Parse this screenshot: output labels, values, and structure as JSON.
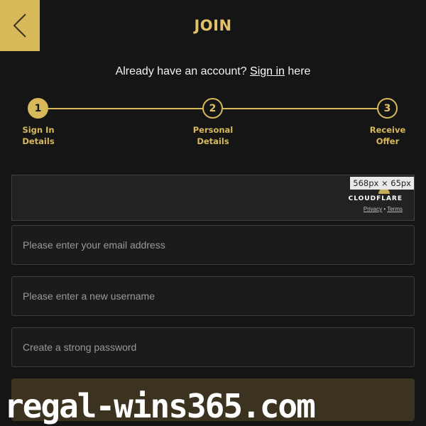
{
  "header": {
    "title": "JOIN",
    "back_icon": "chevron-left-icon"
  },
  "signin": {
    "prefix": "Already have an account? ",
    "link": "Sign in",
    "suffix": " here"
  },
  "steps": [
    {
      "number": "1",
      "label_line1": "Sign In",
      "label_line2": "Details",
      "active": true
    },
    {
      "number": "2",
      "label_line1": "Personal",
      "label_line2": "Details",
      "active": false
    },
    {
      "number": "3",
      "label_line1": "Receive",
      "label_line2": "Offer",
      "active": false
    }
  ],
  "captcha": {
    "dimension_tag": "568px × 65px",
    "brand": "CLOUDFLARE",
    "privacy": "Privacy",
    "separator": " • ",
    "terms": "Terms"
  },
  "form": {
    "email_placeholder": "Please enter your email address",
    "username_placeholder": "Please enter a new username",
    "password_placeholder": "Create a strong password"
  },
  "watermark": "regal-wins365.com",
  "colors": {
    "accent": "#d8b95a",
    "background": "#151515",
    "field_bg": "#1b1b1b",
    "button_bg": "#3b3320"
  }
}
